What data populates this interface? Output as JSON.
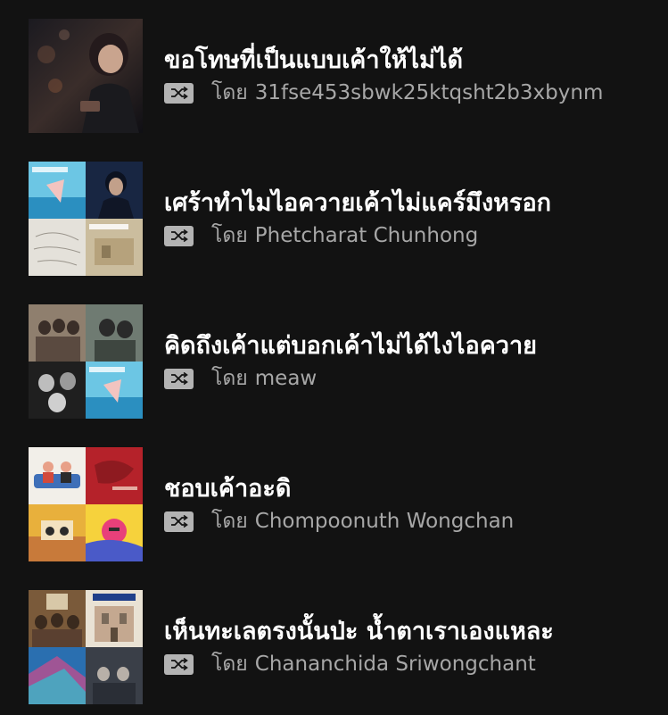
{
  "playlists": [
    {
      "title": "ขอโทษที่เป็นแบบเค้าให้ไม่ได้",
      "by_label": "โดย",
      "owner": "31fse453sbwk25ktqsht2b3xbynm",
      "cover": {
        "style": "single",
        "colors": [
          "#3a2d2a",
          "#1c1a22",
          "#6b4a3a",
          "#0f0f14"
        ]
      }
    },
    {
      "title": "เศร้าทำไมไอควายเค้าไม่แคร์มึงหรอก",
      "by_label": "โดย",
      "owner": "Phetcharat Chunhong",
      "cover": {
        "style": "mosaic",
        "colors": [
          "#4fb6d8",
          "#1a2b4a",
          "#d9d6cf",
          "#c9b99a"
        ]
      }
    },
    {
      "title": "คิดถึงเค้าแต่บอกเค้าไม่ได้ไงไอควาย",
      "by_label": "โดย",
      "owner": "meaw",
      "cover": {
        "style": "mosaic",
        "colors": [
          "#8a7a6a",
          "#5e6b63",
          "#2a2a2a",
          "#5cb8da"
        ]
      }
    },
    {
      "title": "ชอบเค้าอะดิ",
      "by_label": "โดย",
      "owner": "Chompoonuth Wongchan",
      "cover": {
        "style": "mosaic",
        "colors": [
          "#f2efe9",
          "#b5222a",
          "#e8b03c",
          "#e8407a"
        ]
      }
    },
    {
      "title": "เห็นทะเลตรงนั้นป่ะ น้ำตาเราเองแหละ",
      "by_label": "โดย",
      "owner": "Chananchida Sriwongchant",
      "cover": {
        "style": "mosaic",
        "colors": [
          "#7a5a3a",
          "#e9e2d4",
          "#2a6fb0",
          "#3a3f48"
        ]
      }
    }
  ],
  "colors": {
    "background": "#121212",
    "title": "#ffffff",
    "subtitle": "#a7a7a7",
    "shuffle_badge": "#b3b3b3"
  },
  "icons": {
    "shuffle": "shuffle-icon"
  }
}
